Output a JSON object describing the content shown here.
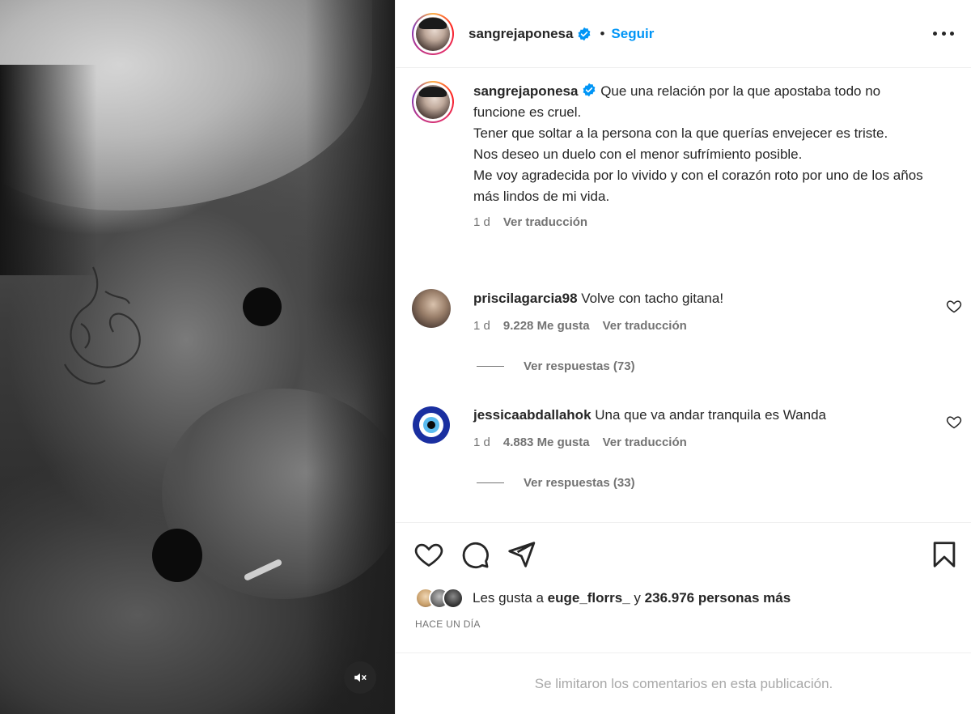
{
  "post": {
    "author": "sangrejaponesa",
    "follow_label": "Seguir",
    "separator": "•",
    "caption_lines": [
      "Que una relación por la que apostaba todo no funcione es cruel.",
      "Tener que soltar a la persona con la que querías envejecer es triste.",
      "Nos deseo un duelo con el menor sufrímiento posible.",
      "Me voy agradecida por lo vivido y con el corazón roto por uno de los años más lindos de mi vida."
    ],
    "caption_time": "1 d",
    "translate_label": "Ver traducción"
  },
  "comments": [
    {
      "user": "priscilagarcia98",
      "text": "Volve con tacho gitana!",
      "time": "1 d",
      "likes": "9.228 Me gusta",
      "translate": "Ver traducción",
      "replies": "Ver respuestas (73)"
    },
    {
      "user": "jessicaabdallahok",
      "text": "Una que va andar tranquila es Wanda",
      "time": "1 d",
      "likes": "4.883 Me gusta",
      "translate": "Ver traducción",
      "replies": "Ver respuestas (33)"
    }
  ],
  "likes_bar": {
    "prefix": "Les gusta a",
    "user": "euge_florrs_",
    "connector": "y",
    "rest": "236.976 personas más"
  },
  "time_ago": "HACE UN DÍA",
  "comments_limited": "Se limitaron los comentarios en esta publicación.",
  "colors": {
    "accent": "#0095f6",
    "text": "#262626",
    "muted": "#737373"
  },
  "icons": [
    "mute-icon",
    "verified-icon",
    "more-icon",
    "heart-icon",
    "comment-icon",
    "share-icon",
    "bookmark-icon"
  ]
}
